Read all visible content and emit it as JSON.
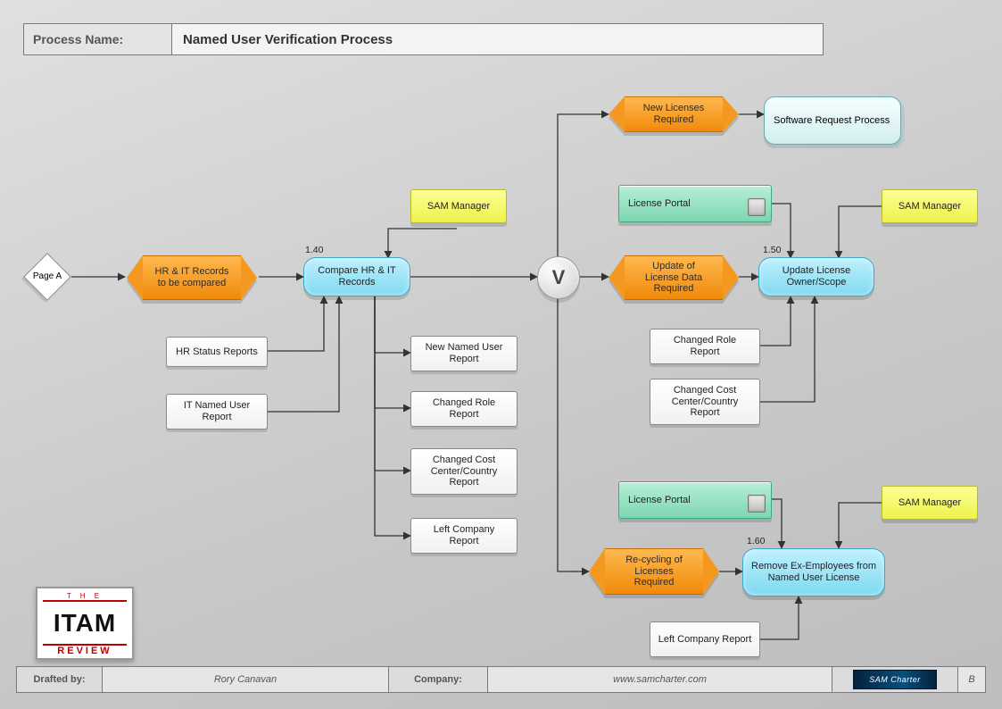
{
  "header": {
    "label": "Process Name:",
    "value": "Named User Verification Process"
  },
  "nodes": {
    "page_a": "Page A",
    "hex_hr_it": "HR & IT Records to be compared",
    "proc_compare": "Compare HR & IT Records",
    "step_compare": "1.40",
    "role_sam_1": "SAM Manager",
    "doc_hr_status": "HR Status Reports",
    "doc_it_named": "IT Named User Report",
    "doc_new_named": "New Named User Report",
    "doc_changed_role_1": "Changed Role Report",
    "doc_changed_cost_1": "Changed Cost Center/Country Report",
    "doc_left_company_1": "Left Company Report",
    "gateway": "V",
    "hex_new_lic": "New Licenses Required",
    "subproc_software_req": "Software Request Process",
    "hex_update_lic": "Update of License Data Required",
    "store_portal_1": "License Portal",
    "role_sam_2": "SAM Manager",
    "proc_update": "Update License Owner/Scope",
    "step_update": "1.50",
    "doc_changed_role_2": "Changed Role Report",
    "doc_changed_cost_2": "Changed Cost Center/Country Report",
    "hex_recycle": "Re-cycling of Licenses Required",
    "store_portal_2": "License Portal",
    "role_sam_3": "SAM Manager",
    "proc_remove": "Remove Ex-Employees from Named User License",
    "step_remove": "1.60",
    "doc_left_company_2": "Left Company Report"
  },
  "footer": {
    "drafted_label": "Drafted by:",
    "drafted_value": "Rory Canavan",
    "company_label": "Company:",
    "company_value": "www.samcharter.com",
    "badge": "SAM Charter",
    "page": "B"
  },
  "logo": {
    "top": "T H E",
    "mid": "ITAM",
    "bot": "REVIEW"
  },
  "colors": {
    "orange": "#f49820",
    "blue": "#8edff2",
    "yellow": "#f4f86a",
    "teal": "#8fddbc"
  }
}
